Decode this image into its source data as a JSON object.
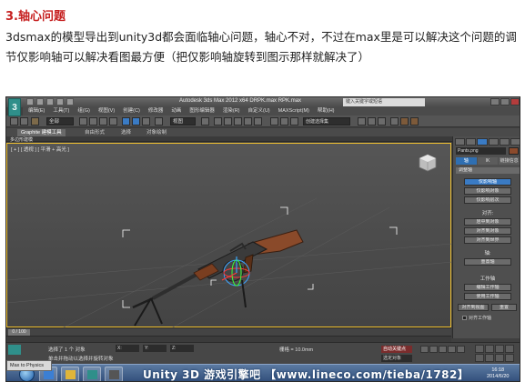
{
  "article": {
    "heading": "3.轴心问题",
    "paragraph": "3dsmax的模型导出到unity3d都会面临轴心问题，轴心不对，不过在max里是可以解决这个问题的调节仅影响轴可以解决看图最方便（把仅影响轴旋转到图示那样就解决了）"
  },
  "screenshot": {
    "app_logo": "3",
    "title": "Autodesk 3ds Max 2012 x64    DRPK.max    RPK.max",
    "search_placeholder": "键入关键字或短语",
    "menu": [
      "编辑(E)",
      "工具(T)",
      "组(G)",
      "视图(V)",
      "创建(C)",
      "修改器",
      "动画",
      "图形编辑器",
      "渲染(R)",
      "自定义(U)",
      "MAXScript(M)",
      "帮助(H)"
    ],
    "toolbar": {
      "selection_filter": "全部",
      "view_dropdown": "视图",
      "selection_set": "创建选择集"
    },
    "ribbon_tabs": [
      "Graphite 建模工具",
      "自由形式",
      "选择",
      "对象绘制"
    ],
    "ribbon_sub": "多边形建模",
    "viewport_label": "[ + ] [ 透视 ] [ 平滑 + 高光 ]",
    "command_panel": {
      "object_name": "Pants.png",
      "subtabs": [
        "轴",
        "IK",
        "链接信息"
      ],
      "rollout_adjust": "调整轴",
      "buttons_move": [
        "仅影响轴",
        "仅影响对象",
        "仅影响层次"
      ],
      "section_align": "对齐:",
      "buttons_align": [
        "居中到对象",
        "对齐到对象",
        "对齐到世界"
      ],
      "section_axis": "轴:",
      "button_reset": "重置轴",
      "section_work": "工作轴",
      "buttons_work": [
        "编辑工作轴",
        "使用工作轴"
      ],
      "buttons_row": [
        "对齐到视图",
        "重置"
      ],
      "checkbox_label": "对齐工作轴"
    },
    "timeline": {
      "slider": "0 / 100"
    },
    "status": {
      "line1": "选择了 1 个 对象",
      "line2": "单击并拖动以选择并旋转对象",
      "fields": [
        "X:",
        "Y:",
        "Z:"
      ],
      "grid": "栅格 = 10.0mm",
      "auto_key": "自动关键点",
      "selected": "选定对象"
    },
    "float_panel": "Max to Physics",
    "watermark": "Unity 3D 游戏引擎吧  【www.lineco.com/tieba/1782】",
    "clock": [
      "16:18",
      "2014/6/20"
    ],
    "colors": {
      "viewport_border": "#f2c230",
      "active_button": "#3a7bc4",
      "heading": "#c62020"
    }
  }
}
